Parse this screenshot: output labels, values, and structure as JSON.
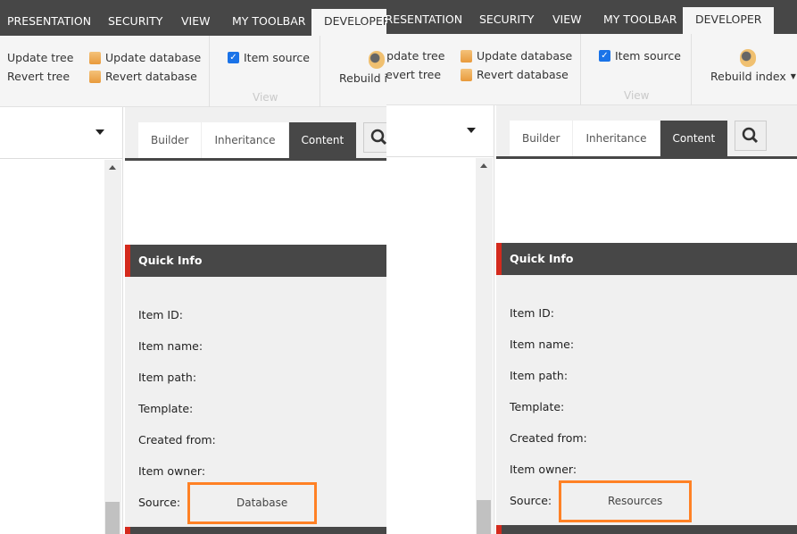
{
  "ribbon": {
    "tabs": [
      "PRESENTATION",
      "SECURITY",
      "VIEW",
      "MY TOOLBAR",
      "DEVELOPER"
    ],
    "active_tab": "DEVELOPER",
    "update_tree": "Update tree",
    "revert_tree": "Revert tree",
    "update_database": "Update database",
    "revert_database": "Revert database",
    "item_source": "Item source",
    "item_source_checked": true,
    "view_group": "View",
    "rebuild_index": "Rebuild index"
  },
  "editor": {
    "tabs": [
      "Builder",
      "Inheritance",
      "Content"
    ],
    "active_tab": "Content",
    "quick_info": "Quick Info",
    "fields": [
      "Item ID:",
      "Item name:",
      "Item path:",
      "Template:",
      "Created from:",
      "Item owner:",
      "Source:"
    ]
  },
  "left": {
    "source_value": "Database"
  },
  "right": {
    "source_value": "Resources"
  },
  "colors": {
    "accent": "#d42a1d",
    "highlight": "#ff8125",
    "dark": "#474747"
  }
}
